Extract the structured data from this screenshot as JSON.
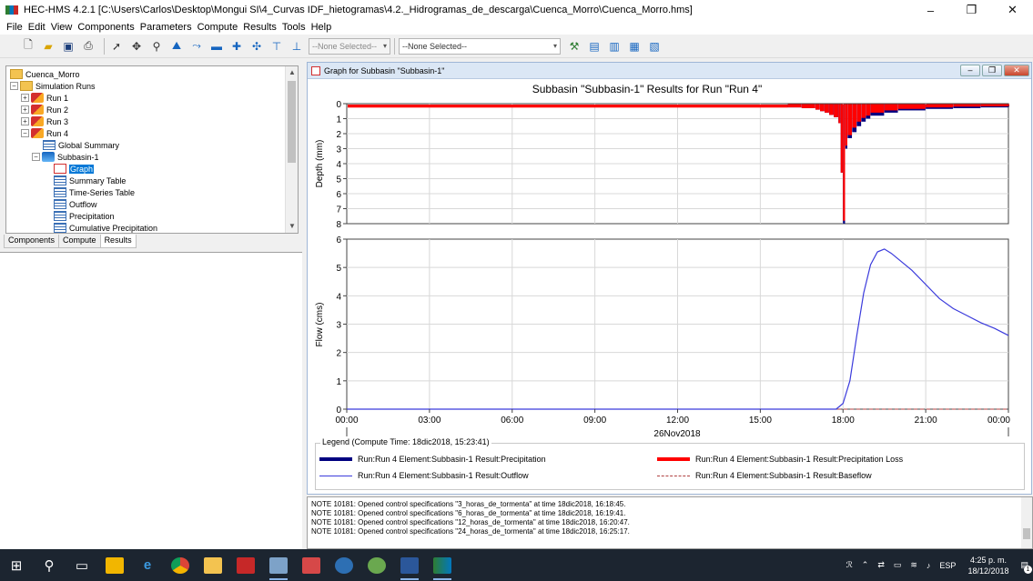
{
  "window": {
    "title": "HEC-HMS 4.2.1 [C:\\Users\\Carlos\\Desktop\\Mongui SI\\4_Curvas IDF_hietogramas\\4.2._Hidrogramas_de_descarga\\Cuenca_Morro\\Cuenca_Morro.hms]",
    "minimize": "–",
    "restore": "❐",
    "close": "✕"
  },
  "menu": [
    "File",
    "Edit",
    "View",
    "Components",
    "Parameters",
    "Compute",
    "Results",
    "Tools",
    "Help"
  ],
  "toolbar": {
    "select1": "--None Selected--",
    "select2": "--None Selected--"
  },
  "tree": {
    "root": "Cuenca_Morro",
    "simulation_runs": "Simulation Runs",
    "runs": [
      "Run 1",
      "Run 2",
      "Run 3",
      "Run 4"
    ],
    "global_summary": "Global Summary",
    "subbasin": "Subbasin-1",
    "results": [
      "Graph",
      "Summary Table",
      "Time-Series Table",
      "Outflow",
      "Precipitation",
      "Cumulative Precipitation"
    ]
  },
  "tabs": [
    "Components",
    "Compute",
    "Results"
  ],
  "graph_window": {
    "title": "Graph for Subbasin \"Subbasin-1\""
  },
  "legend": {
    "title": "Legend (Compute Time: 18dic2018, 15:23:41)",
    "items": [
      "Run:Run 4 Element:Subbasin-1 Result:Precipitation",
      "Run:Run 4 Element:Subbasin-1 Result:Precipitation Loss",
      "Run:Run 4 Element:Subbasin-1 Result:Outflow",
      "Run:Run 4 Element:Subbasin-1 Result:Baseflow"
    ]
  },
  "log": [
    "NOTE 10181:  Opened control specifications \"3_horas_de_tormenta\" at time 18dic2018, 16:18:45.",
    "NOTE 10181:  Opened control specifications \"6_horas_de_tormenta\" at time 18dic2018, 16:19:41.",
    "NOTE 10181:  Opened control specifications \"12_horas_de_tormenta\" at time 18dic2018, 16:20:47.",
    "NOTE 10181:  Opened control specifications \"24_horas_de_tormenta\" at time 18dic2018, 16:25:17."
  ],
  "taskbar": {
    "language": "ESP",
    "time": "4:25 p. m.",
    "date": "18/12/2018",
    "notification_count": "1"
  },
  "colors": {
    "precipitation": "#000080",
    "precipitation_loss": "#ff0000",
    "outflow": "#3b3bdc",
    "baseflow": "#b04040"
  },
  "chart_data": [
    {
      "type": "bar",
      "title": "Subbasin \"Subbasin-1\" Results for Run \"Run 4\"",
      "ylabel": "Depth (mm)",
      "ylim": [
        0,
        8
      ],
      "y_inverted": true,
      "yticks": [
        "0",
        "1",
        "2",
        "3",
        "4",
        "5",
        "6",
        "7",
        "8"
      ],
      "x": [
        "16:00",
        "16:30",
        "17:00",
        "17:10",
        "17:20",
        "17:30",
        "17:40",
        "17:50",
        "17:55",
        "18:00",
        "18:05",
        "18:10",
        "18:20",
        "18:30",
        "18:40",
        "18:50",
        "19:00",
        "19:30",
        "20:00",
        "21:00",
        "22:00",
        "23:00",
        "24:00"
      ],
      "series": [
        {
          "name": "Run:Run 4 Element:Subbasin-1 Result:Precipitation",
          "values": [
            0.25,
            0.3,
            0.4,
            0.5,
            0.6,
            0.75,
            0.9,
            1.3,
            4.6,
            8.0,
            3.0,
            2.3,
            1.9,
            1.5,
            1.2,
            1.0,
            0.8,
            0.6,
            0.45,
            0.35,
            0.3,
            0.25,
            0.2
          ]
        },
        {
          "name": "Run:Run 4 Element:Subbasin-1 Result:Precipitation Loss",
          "values": [
            0.25,
            0.3,
            0.4,
            0.5,
            0.6,
            0.75,
            0.9,
            1.3,
            4.6,
            7.8,
            2.8,
            2.1,
            1.6,
            1.2,
            0.95,
            0.8,
            0.6,
            0.45,
            0.35,
            0.25,
            0.2,
            0.18,
            0.15
          ]
        }
      ]
    },
    {
      "type": "line",
      "ylabel": "Flow (cms)",
      "ylim": [
        0,
        6
      ],
      "yticks": [
        "0",
        "1",
        "2",
        "3",
        "4",
        "5",
        "6"
      ],
      "xticks": [
        "00:00",
        "03:00",
        "06:00",
        "09:00",
        "12:00",
        "15:00",
        "18:00",
        "21:00",
        "00:00"
      ],
      "xlabel": "26Nov2018",
      "series": [
        {
          "name": "Run:Run 4 Element:Subbasin-1 Result:Outflow",
          "x": [
            "00:00",
            "17:45",
            "18:00",
            "18:15",
            "18:30",
            "18:45",
            "19:00",
            "19:15",
            "19:30",
            "19:45",
            "20:00",
            "20:30",
            "21:00",
            "21:30",
            "22:00",
            "22:30",
            "23:00",
            "23:30",
            "24:00"
          ],
          "values": [
            0,
            0,
            0.2,
            1.0,
            2.6,
            4.1,
            5.1,
            5.55,
            5.65,
            5.5,
            5.3,
            4.9,
            4.4,
            3.9,
            3.55,
            3.3,
            3.05,
            2.85,
            2.6
          ]
        },
        {
          "name": "Run:Run 4 Element:Subbasin-1 Result:Baseflow",
          "x": [
            "00:00",
            "24:00"
          ],
          "values": [
            0,
            0
          ]
        }
      ]
    }
  ]
}
